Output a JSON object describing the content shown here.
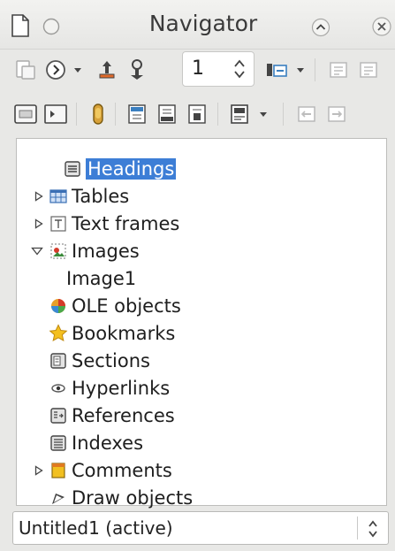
{
  "window": {
    "title": "Navigator"
  },
  "toolbar": {
    "heading_level_value": "1"
  },
  "tree": {
    "items": [
      {
        "label": "Headings",
        "icon": "headings-icon",
        "expander": "none",
        "selected": true
      },
      {
        "label": "Tables",
        "icon": "tables-icon",
        "expander": "collapsed"
      },
      {
        "label": "Text frames",
        "icon": "text-frames-icon",
        "expander": "collapsed"
      },
      {
        "label": "Images",
        "icon": "images-icon",
        "expander": "expanded"
      },
      {
        "label": "Image1",
        "icon": "",
        "expander": "none",
        "child": true
      },
      {
        "label": "OLE objects",
        "icon": "ole-objects-icon",
        "expander": "none"
      },
      {
        "label": "Bookmarks",
        "icon": "bookmarks-icon",
        "expander": "none"
      },
      {
        "label": "Sections",
        "icon": "sections-icon",
        "expander": "none"
      },
      {
        "label": "Hyperlinks",
        "icon": "hyperlinks-icon",
        "expander": "none"
      },
      {
        "label": "References",
        "icon": "references-icon",
        "expander": "none"
      },
      {
        "label": "Indexes",
        "icon": "indexes-icon",
        "expander": "none"
      },
      {
        "label": "Comments",
        "icon": "comments-icon",
        "expander": "collapsed"
      },
      {
        "label": "Draw objects",
        "icon": "draw-objects-icon",
        "expander": "none"
      }
    ]
  },
  "document_selector": {
    "value": "Untitled1 (active)"
  },
  "colors": {
    "selection": "#3d7ed6",
    "window_bg": "#e8e8e6",
    "tree_bg": "#ffffff"
  }
}
